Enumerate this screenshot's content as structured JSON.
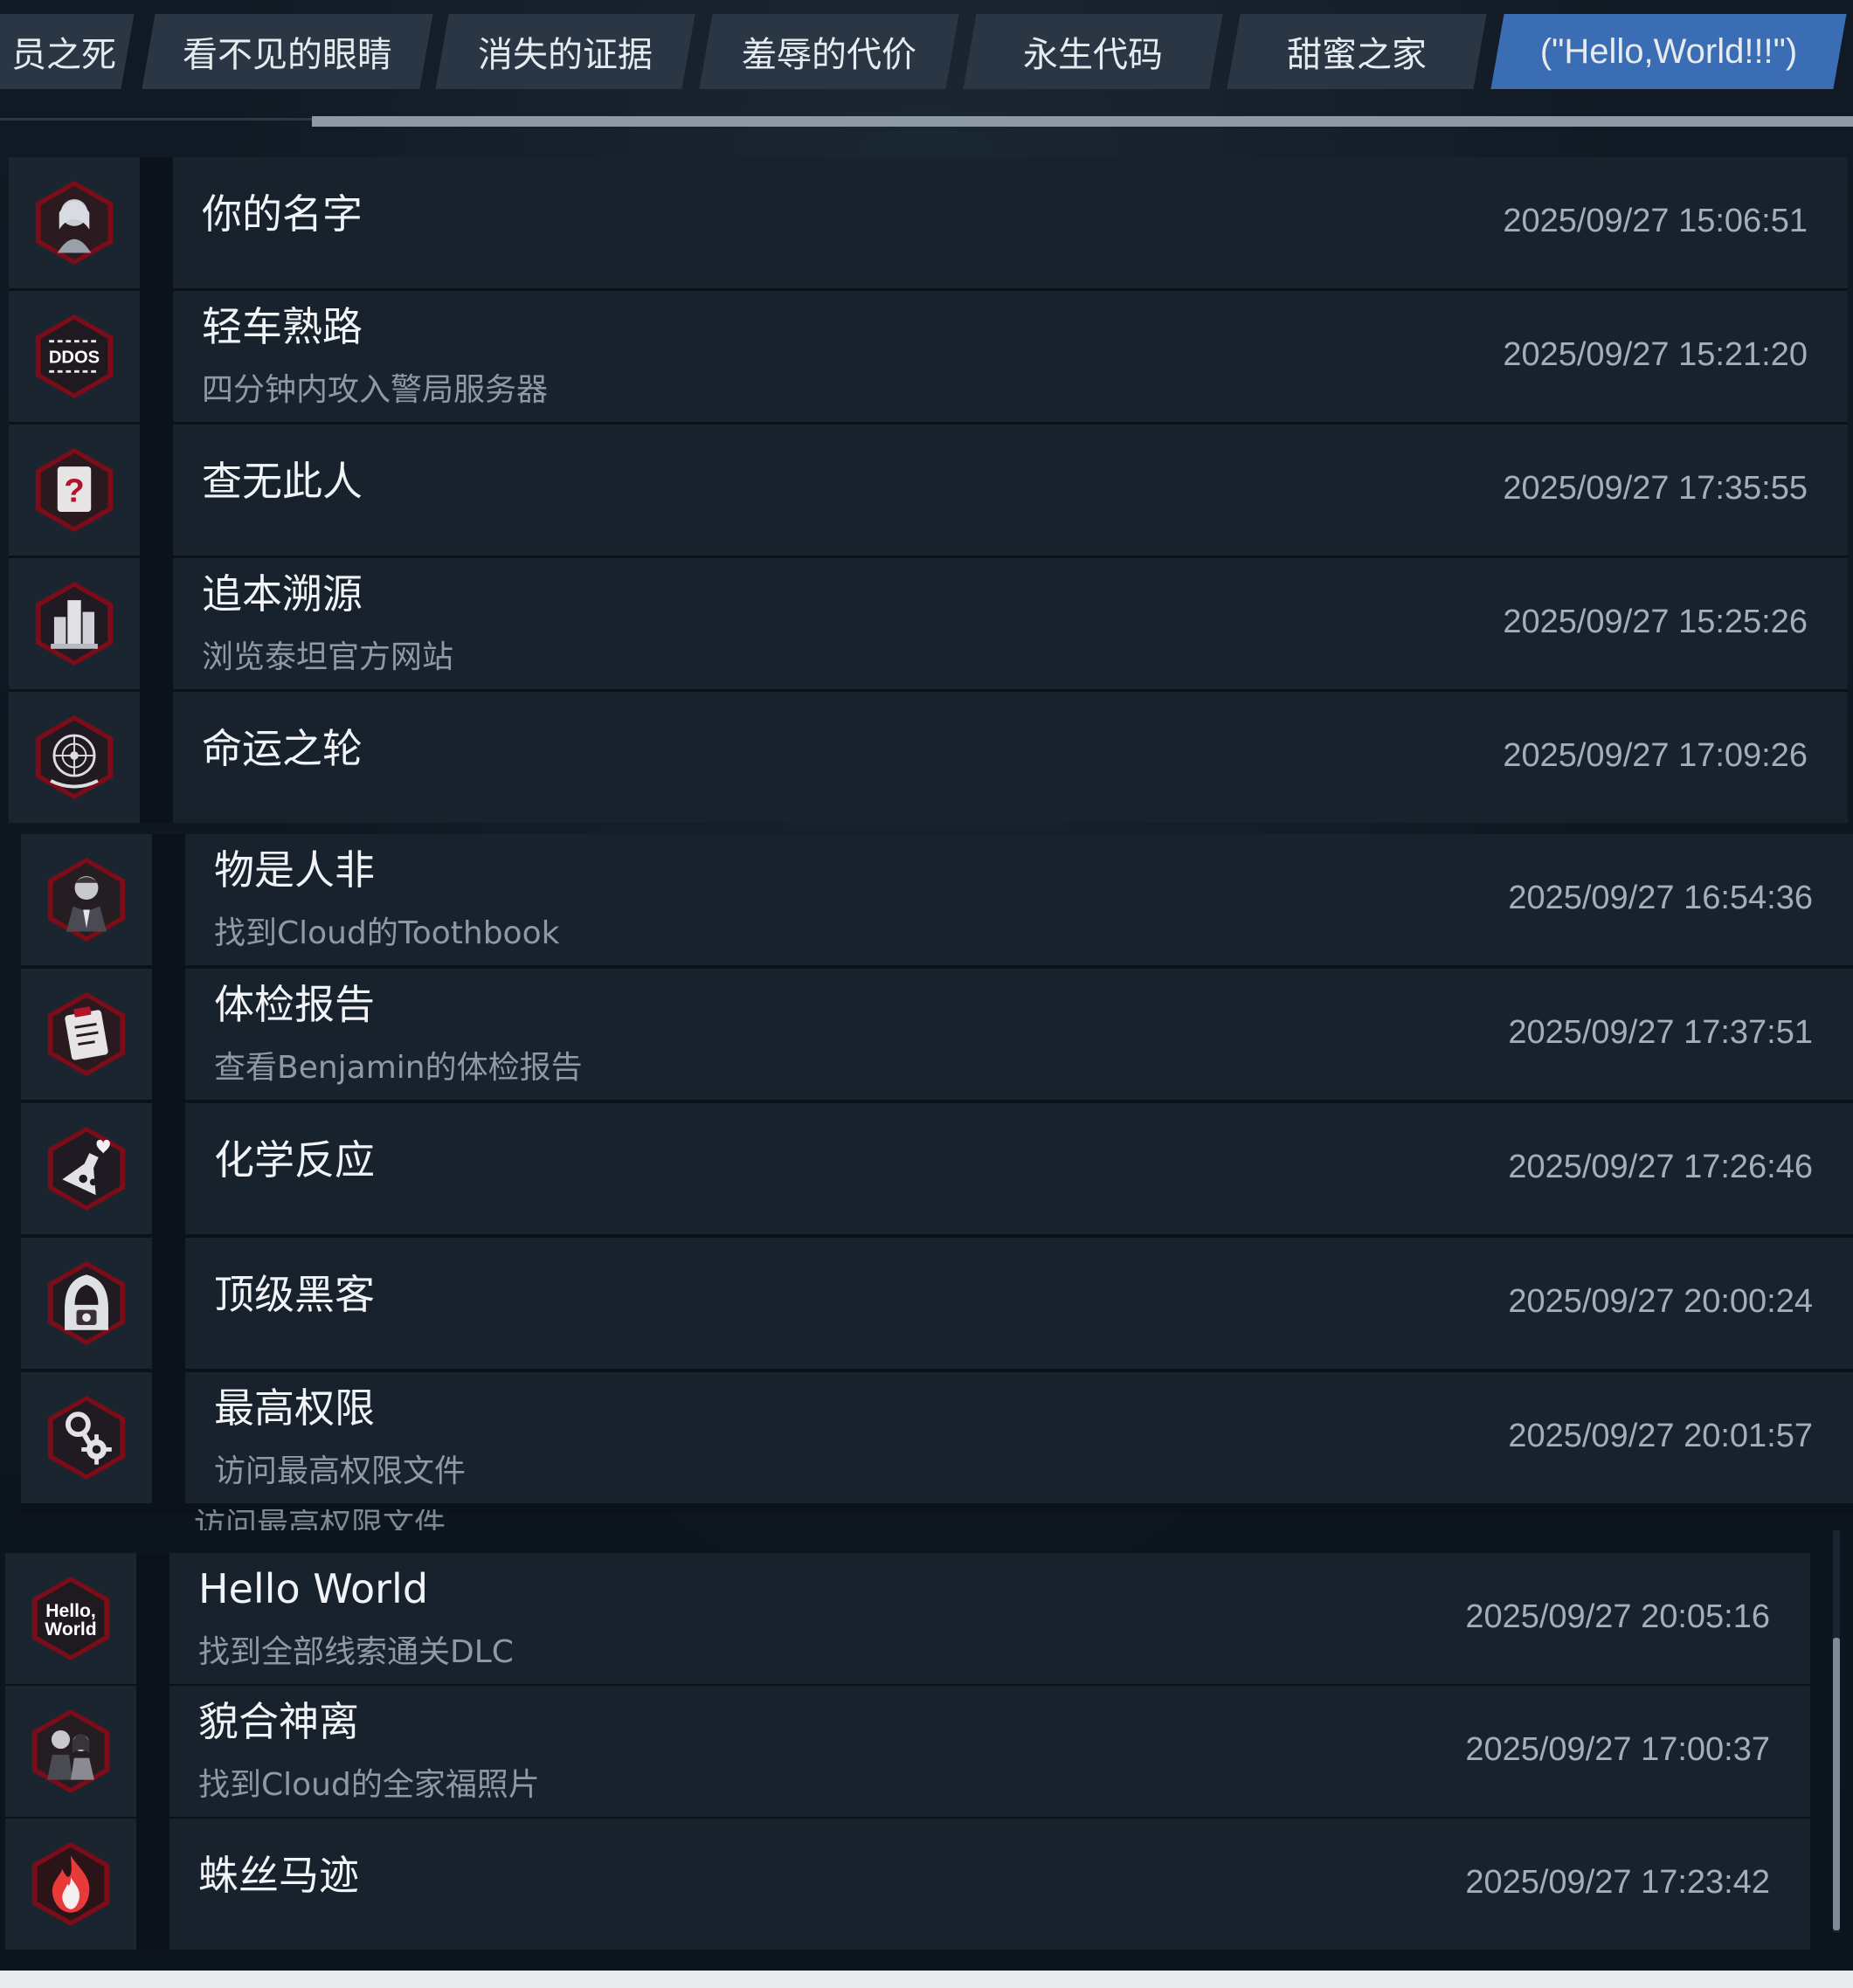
{
  "tabs": [
    {
      "label": "员之死",
      "active": false
    },
    {
      "label": "看不见的眼睛",
      "active": false
    },
    {
      "label": "消失的证据",
      "active": false
    },
    {
      "label": "羞辱的代价",
      "active": false
    },
    {
      "label": "永生代码",
      "active": false
    },
    {
      "label": "甜蜜之家",
      "active": false
    },
    {
      "label": "(\"Hello,World!!!\")",
      "active": true
    }
  ],
  "achievements": [
    {
      "title": "你的名字",
      "subtitle": "",
      "time": "2025/09/27 15:06:51",
      "icon": "girl-portrait-icon"
    },
    {
      "title": "轻车熟路",
      "subtitle": "四分钟内攻入警局服务器",
      "time": "2025/09/27 15:21:20",
      "icon": "ddos-icon"
    },
    {
      "title": "查无此人",
      "subtitle": "",
      "time": "2025/09/27 17:35:55",
      "icon": "question-card-icon"
    },
    {
      "title": "追本溯源",
      "subtitle": "浏览泰坦官方网站",
      "time": "2025/09/27 15:25:26",
      "icon": "buildings-icon"
    },
    {
      "title": "命运之轮",
      "subtitle": "",
      "time": "2025/09/27 17:09:26",
      "icon": "wheel-of-fate-icon"
    },
    {
      "title": "物是人非",
      "subtitle": "找到Cloud的Toothbook",
      "time": "2025/09/27 16:54:36",
      "icon": "man-portrait-icon"
    },
    {
      "title": "体检报告",
      "subtitle": "查看Benjamin的体检报告",
      "time": "2025/09/27 17:37:51",
      "icon": "clipboard-report-icon"
    },
    {
      "title": "化学反应",
      "subtitle": "",
      "time": "2025/09/27 17:26:46",
      "icon": "flask-heart-icon"
    },
    {
      "title": "顶级黑客",
      "subtitle": "",
      "time": "2025/09/27 20:00:24",
      "icon": "hooded-hacker-icon"
    },
    {
      "title": "最高权限",
      "subtitle": "访问最高权限文件",
      "time": "2025/09/27 20:01:57",
      "icon": "key-gear-icon"
    },
    {
      "title": "Hello World",
      "subtitle": "找到全部线索通关DLC",
      "time": "2025/09/27 20:05:16",
      "icon": "hello-world-icon"
    },
    {
      "title": "貌合神离",
      "subtitle": "找到Cloud的全家福照片",
      "time": "2025/09/27 17:00:37",
      "icon": "couple-portrait-icon"
    },
    {
      "title": "蛛丝马迹",
      "subtitle": "",
      "time": "2025/09/27 17:23:42",
      "icon": "flame-icon"
    }
  ],
  "badge_text": {
    "ddos": "DDOS",
    "hello_line1": "Hello,",
    "hello_line2": "World",
    "question": "?"
  },
  "peek_subtitle": "访问最高权限文件",
  "colors": {
    "active_tab": "#3a6db3",
    "badge_rim": "#b3142a"
  }
}
